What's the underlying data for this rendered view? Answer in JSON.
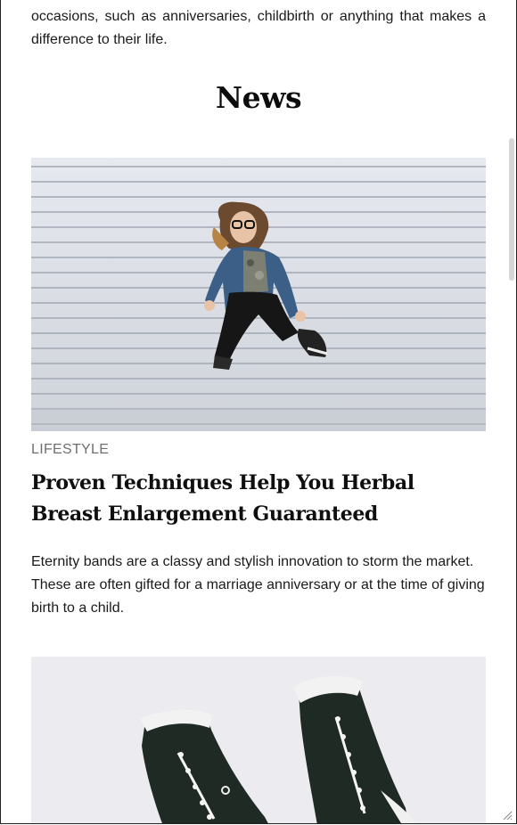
{
  "intro": {
    "text": "occasions, such as anniversaries, childbirth or anything that makes a difference to their life."
  },
  "section": {
    "title": "News"
  },
  "articles": [
    {
      "image_alt": "Woman jumping in front of a white shutter wall",
      "category": "LIFESTYLE",
      "title": "Proven Techniques Help You Herbal Breast Enlargement Guaranteed",
      "excerpt": "Eternity bands are a classy and stylish innovation to storm the market. These are often gifted for a marriage anniversary or at the time of giving birth to a child."
    },
    {
      "image_alt": "Pair of dark green canvas sneakers"
    }
  ],
  "colors": {
    "title": "#0c0c0c",
    "category": "#6f6f6f",
    "body_text": "#1a1a1a",
    "background": "#ffffff"
  }
}
